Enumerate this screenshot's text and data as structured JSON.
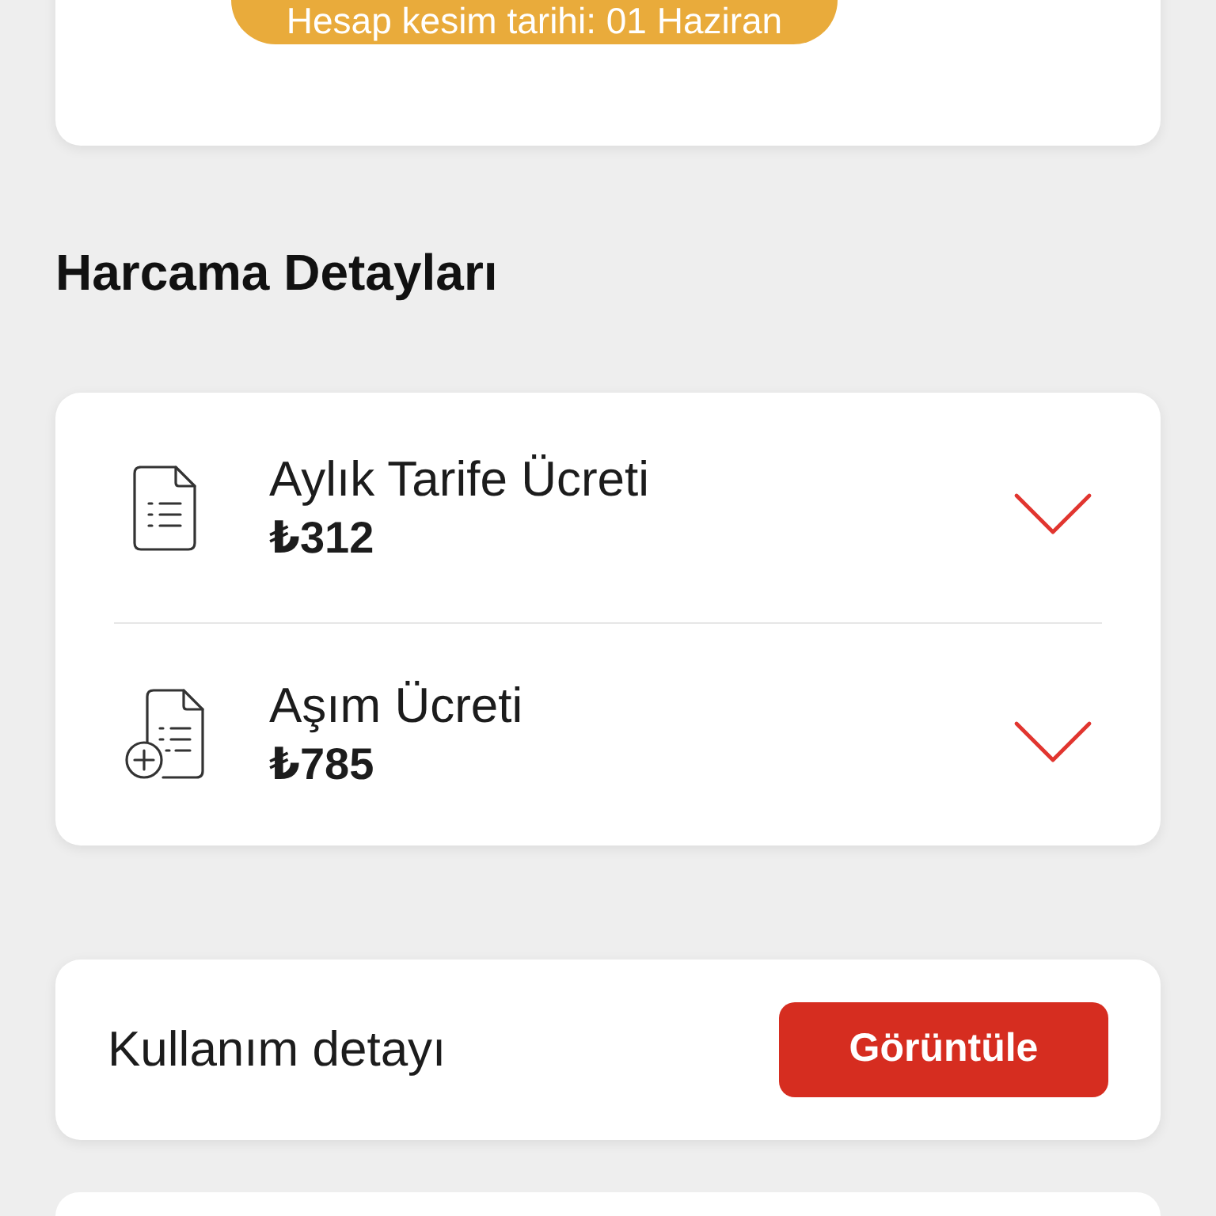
{
  "summary_card": {
    "billing_date_badge": "Hesap kesim tarihi: 01 Haziran"
  },
  "section_title": "Harcama Detayları",
  "charges": [
    {
      "kind": "monthly",
      "title": "Aylık Tarife Ücreti",
      "amount": "₺312",
      "expanded": false
    },
    {
      "kind": "overage",
      "title": "Aşım Ücreti",
      "amount": "₺785",
      "expanded": false
    }
  ],
  "usage_card": {
    "label": "Kullanım detayı",
    "button": "Görüntüle"
  }
}
